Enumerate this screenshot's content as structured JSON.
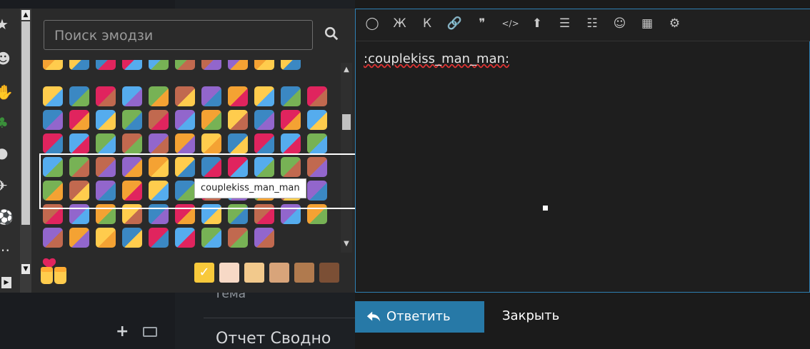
{
  "page": {
    "topic_label": "Тема",
    "report_label": "Отчет Сводно"
  },
  "picker": {
    "search_placeholder": "Поиск эмодзи",
    "tooltip": "couplekiss_man_man",
    "categories": [
      "star-icon",
      "smiley-icon",
      "hand-icon",
      "tree-icon",
      "burger-icon",
      "plane-icon",
      "ball-icon",
      "dots-icon",
      "symbol-icon"
    ],
    "skin_tones": [
      "#f8c93b",
      "#f7d9c6",
      "#f2c98c",
      "#d8a47a",
      "#b07a4e",
      "#7b4f35"
    ],
    "selected_tone_index": 0
  },
  "editor": {
    "text": ":couplekiss_man_man:",
    "toolbar": [
      "speech-bubble-icon",
      "bold-icon",
      "italic-icon",
      "link-icon",
      "quote-icon",
      "code-icon",
      "upload-icon",
      "bullet-list-icon",
      "numbered-list-icon",
      "emoji-icon",
      "calendar-icon",
      "settings-icon"
    ],
    "toolbar_glyphs": [
      "◯",
      "Ж",
      "К",
      "🔗",
      "❞",
      "</>",
      "⬆",
      "☰",
      "☷",
      "☺",
      "▦",
      "⚙"
    ]
  },
  "actions": {
    "reply_label": "Ответить",
    "close_label": "Закрыть"
  },
  "colors": {
    "accent": "#2779a7",
    "editor_border": "#2e7fb3"
  }
}
